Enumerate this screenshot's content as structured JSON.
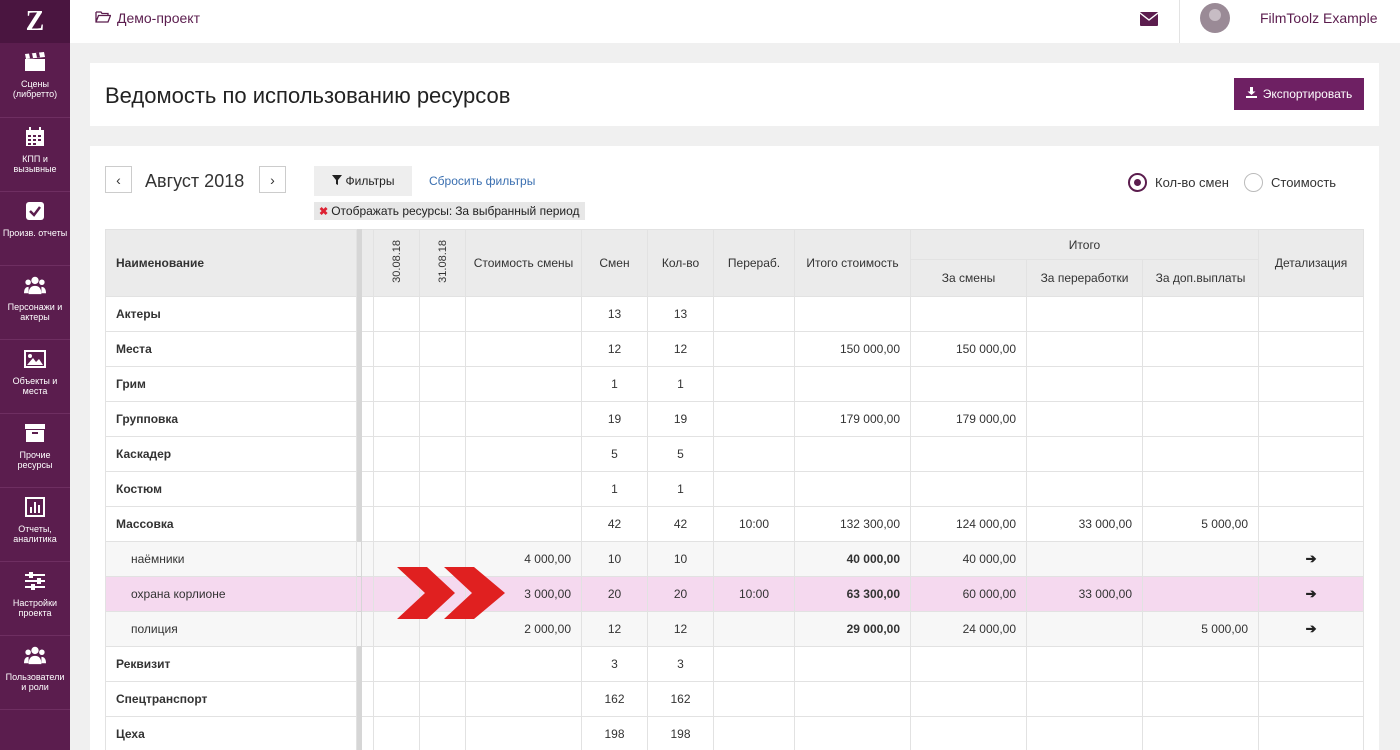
{
  "sidebar": {
    "logo": "Z",
    "items": [
      {
        "label": "Сцены (либретто)",
        "icon": "clapperboard-icon"
      },
      {
        "label": "КПП и вызывные",
        "icon": "calendar-icon"
      },
      {
        "label": "Произв. отчеты",
        "icon": "checkbox-icon"
      },
      {
        "label": "Персонажи и актеры",
        "icon": "people-icon"
      },
      {
        "label": "Объекты и места",
        "icon": "picture-icon"
      },
      {
        "label": "Прочие ресурсы",
        "icon": "archive-icon"
      },
      {
        "label": "Отчеты, аналитика",
        "icon": "chart-icon"
      },
      {
        "label": "Настройки проекта",
        "icon": "sliders-icon"
      },
      {
        "label": "Пользователи и роли",
        "icon": "users-icon"
      }
    ]
  },
  "topbar": {
    "project": "Демо-проект",
    "user_name": "FilmToolz Example"
  },
  "header": {
    "title": "Ведомость по использованию ресурсов",
    "export_label": "Экспортировать"
  },
  "controls": {
    "prev": "‹",
    "next": "›",
    "month": "Август 2018",
    "filters_label": "Фильтры",
    "reset_label": "Сбросить фильтры",
    "chip_label": "Отображать ресурсы:",
    "chip_value": "За выбранный период",
    "radio_shifts": "Кол-во смен",
    "radio_cost": "Стоимость",
    "selected": "shifts"
  },
  "table": {
    "headers": {
      "name": "Наименование",
      "date1": "30.08.18",
      "date2": "31.08.18",
      "shift_cost": "Стоимость смены",
      "shifts": "Смен",
      "qty": "Кол-во",
      "overtime": "Перераб.",
      "total_cost": "Итого стоимость",
      "total_group": "Итого",
      "for_shifts": "За смены",
      "for_overtime": "За переработки",
      "for_extra": "За доп.выплаты",
      "details": "Детализация"
    },
    "rows": [
      {
        "name": "Актеры",
        "shift_cost": "",
        "shifts": "13",
        "qty": "13",
        "overtime": "",
        "total": "",
        "for_shifts": "",
        "for_overtime": "",
        "for_extra": "",
        "detail": ""
      },
      {
        "name": "Места",
        "shift_cost": "",
        "shifts": "12",
        "qty": "12",
        "overtime": "",
        "total": "150 000,00",
        "for_shifts": "150 000,00",
        "for_overtime": "",
        "for_extra": "",
        "detail": ""
      },
      {
        "name": "Грим",
        "shift_cost": "",
        "shifts": "1",
        "qty": "1",
        "overtime": "",
        "total": "",
        "for_shifts": "",
        "for_overtime": "",
        "for_extra": "",
        "detail": ""
      },
      {
        "name": "Групповка",
        "shift_cost": "",
        "shifts": "19",
        "qty": "19",
        "overtime": "",
        "total": "179 000,00",
        "for_shifts": "179 000,00",
        "for_overtime": "",
        "for_extra": "",
        "detail": ""
      },
      {
        "name": "Каскадер",
        "shift_cost": "",
        "shifts": "5",
        "qty": "5",
        "overtime": "",
        "total": "",
        "for_shifts": "",
        "for_overtime": "",
        "for_extra": "",
        "detail": ""
      },
      {
        "name": "Костюм",
        "shift_cost": "",
        "shifts": "1",
        "qty": "1",
        "overtime": "",
        "total": "",
        "for_shifts": "",
        "for_overtime": "",
        "for_extra": "",
        "detail": ""
      },
      {
        "name": "Массовка",
        "shift_cost": "",
        "shifts": "42",
        "qty": "42",
        "overtime": "10:00",
        "total": "132 300,00",
        "for_shifts": "124 000,00",
        "for_overtime": "33 000,00",
        "for_extra": "5 000,00",
        "detail": ""
      },
      {
        "name": "наёмники",
        "shift_cost": "4 000,00",
        "shifts": "10",
        "qty": "10",
        "overtime": "",
        "total": "40 000,00",
        "for_shifts": "40 000,00",
        "for_overtime": "",
        "for_extra": "",
        "detail": "➔"
      },
      {
        "name": "охрана корлионе",
        "shift_cost": "3 000,00",
        "shifts": "20",
        "qty": "20",
        "overtime": "10:00",
        "total": "63 300,00",
        "for_shifts": "60 000,00",
        "for_overtime": "33 000,00",
        "for_extra": "",
        "detail": "➔"
      },
      {
        "name": "полиция",
        "shift_cost": "2 000,00",
        "shifts": "12",
        "qty": "12",
        "overtime": "",
        "total": "29 000,00",
        "for_shifts": "24 000,00",
        "for_overtime": "",
        "for_extra": "5 000,00",
        "detail": "➔"
      },
      {
        "name": "Реквизит",
        "shift_cost": "",
        "shifts": "3",
        "qty": "3",
        "overtime": "",
        "total": "",
        "for_shifts": "",
        "for_overtime": "",
        "for_extra": "",
        "detail": ""
      },
      {
        "name": "Спецтранспорт",
        "shift_cost": "",
        "shifts": "162",
        "qty": "162",
        "overtime": "",
        "total": "",
        "for_shifts": "",
        "for_overtime": "",
        "for_extra": "",
        "detail": ""
      },
      {
        "name": "Цеха",
        "shift_cost": "",
        "shifts": "198",
        "qty": "198",
        "overtime": "",
        "total": "",
        "for_shifts": "",
        "for_overtime": "",
        "for_extra": "",
        "detail": ""
      }
    ]
  },
  "colors": {
    "brand": "#5b1d4e",
    "highlight_row": "#f5d9ef",
    "annotation_arrow": "#e02020"
  }
}
